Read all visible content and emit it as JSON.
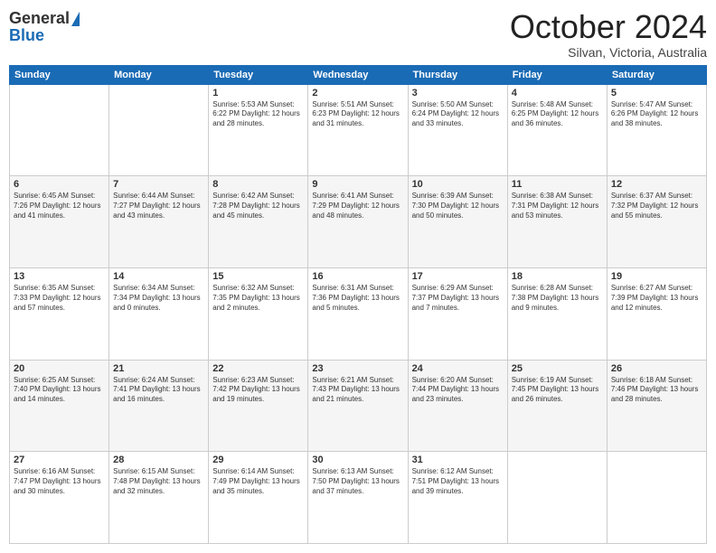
{
  "header": {
    "logo_line1": "General",
    "logo_line2": "Blue",
    "month": "October 2024",
    "location": "Silvan, Victoria, Australia"
  },
  "days_of_week": [
    "Sunday",
    "Monday",
    "Tuesday",
    "Wednesday",
    "Thursday",
    "Friday",
    "Saturday"
  ],
  "weeks": [
    [
      {
        "day": "",
        "info": ""
      },
      {
        "day": "",
        "info": ""
      },
      {
        "day": "1",
        "info": "Sunrise: 5:53 AM\nSunset: 6:22 PM\nDaylight: 12 hours and 28 minutes."
      },
      {
        "day": "2",
        "info": "Sunrise: 5:51 AM\nSunset: 6:23 PM\nDaylight: 12 hours and 31 minutes."
      },
      {
        "day": "3",
        "info": "Sunrise: 5:50 AM\nSunset: 6:24 PM\nDaylight: 12 hours and 33 minutes."
      },
      {
        "day": "4",
        "info": "Sunrise: 5:48 AM\nSunset: 6:25 PM\nDaylight: 12 hours and 36 minutes."
      },
      {
        "day": "5",
        "info": "Sunrise: 5:47 AM\nSunset: 6:26 PM\nDaylight: 12 hours and 38 minutes."
      }
    ],
    [
      {
        "day": "6",
        "info": "Sunrise: 6:45 AM\nSunset: 7:26 PM\nDaylight: 12 hours and 41 minutes."
      },
      {
        "day": "7",
        "info": "Sunrise: 6:44 AM\nSunset: 7:27 PM\nDaylight: 12 hours and 43 minutes."
      },
      {
        "day": "8",
        "info": "Sunrise: 6:42 AM\nSunset: 7:28 PM\nDaylight: 12 hours and 45 minutes."
      },
      {
        "day": "9",
        "info": "Sunrise: 6:41 AM\nSunset: 7:29 PM\nDaylight: 12 hours and 48 minutes."
      },
      {
        "day": "10",
        "info": "Sunrise: 6:39 AM\nSunset: 7:30 PM\nDaylight: 12 hours and 50 minutes."
      },
      {
        "day": "11",
        "info": "Sunrise: 6:38 AM\nSunset: 7:31 PM\nDaylight: 12 hours and 53 minutes."
      },
      {
        "day": "12",
        "info": "Sunrise: 6:37 AM\nSunset: 7:32 PM\nDaylight: 12 hours and 55 minutes."
      }
    ],
    [
      {
        "day": "13",
        "info": "Sunrise: 6:35 AM\nSunset: 7:33 PM\nDaylight: 12 hours and 57 minutes."
      },
      {
        "day": "14",
        "info": "Sunrise: 6:34 AM\nSunset: 7:34 PM\nDaylight: 13 hours and 0 minutes."
      },
      {
        "day": "15",
        "info": "Sunrise: 6:32 AM\nSunset: 7:35 PM\nDaylight: 13 hours and 2 minutes."
      },
      {
        "day": "16",
        "info": "Sunrise: 6:31 AM\nSunset: 7:36 PM\nDaylight: 13 hours and 5 minutes."
      },
      {
        "day": "17",
        "info": "Sunrise: 6:29 AM\nSunset: 7:37 PM\nDaylight: 13 hours and 7 minutes."
      },
      {
        "day": "18",
        "info": "Sunrise: 6:28 AM\nSunset: 7:38 PM\nDaylight: 13 hours and 9 minutes."
      },
      {
        "day": "19",
        "info": "Sunrise: 6:27 AM\nSunset: 7:39 PM\nDaylight: 13 hours and 12 minutes."
      }
    ],
    [
      {
        "day": "20",
        "info": "Sunrise: 6:25 AM\nSunset: 7:40 PM\nDaylight: 13 hours and 14 minutes."
      },
      {
        "day": "21",
        "info": "Sunrise: 6:24 AM\nSunset: 7:41 PM\nDaylight: 13 hours and 16 minutes."
      },
      {
        "day": "22",
        "info": "Sunrise: 6:23 AM\nSunset: 7:42 PM\nDaylight: 13 hours and 19 minutes."
      },
      {
        "day": "23",
        "info": "Sunrise: 6:21 AM\nSunset: 7:43 PM\nDaylight: 13 hours and 21 minutes."
      },
      {
        "day": "24",
        "info": "Sunrise: 6:20 AM\nSunset: 7:44 PM\nDaylight: 13 hours and 23 minutes."
      },
      {
        "day": "25",
        "info": "Sunrise: 6:19 AM\nSunset: 7:45 PM\nDaylight: 13 hours and 26 minutes."
      },
      {
        "day": "26",
        "info": "Sunrise: 6:18 AM\nSunset: 7:46 PM\nDaylight: 13 hours and 28 minutes."
      }
    ],
    [
      {
        "day": "27",
        "info": "Sunrise: 6:16 AM\nSunset: 7:47 PM\nDaylight: 13 hours and 30 minutes."
      },
      {
        "day": "28",
        "info": "Sunrise: 6:15 AM\nSunset: 7:48 PM\nDaylight: 13 hours and 32 minutes."
      },
      {
        "day": "29",
        "info": "Sunrise: 6:14 AM\nSunset: 7:49 PM\nDaylight: 13 hours and 35 minutes."
      },
      {
        "day": "30",
        "info": "Sunrise: 6:13 AM\nSunset: 7:50 PM\nDaylight: 13 hours and 37 minutes."
      },
      {
        "day": "31",
        "info": "Sunrise: 6:12 AM\nSunset: 7:51 PM\nDaylight: 13 hours and 39 minutes."
      },
      {
        "day": "",
        "info": ""
      },
      {
        "day": "",
        "info": ""
      }
    ]
  ]
}
